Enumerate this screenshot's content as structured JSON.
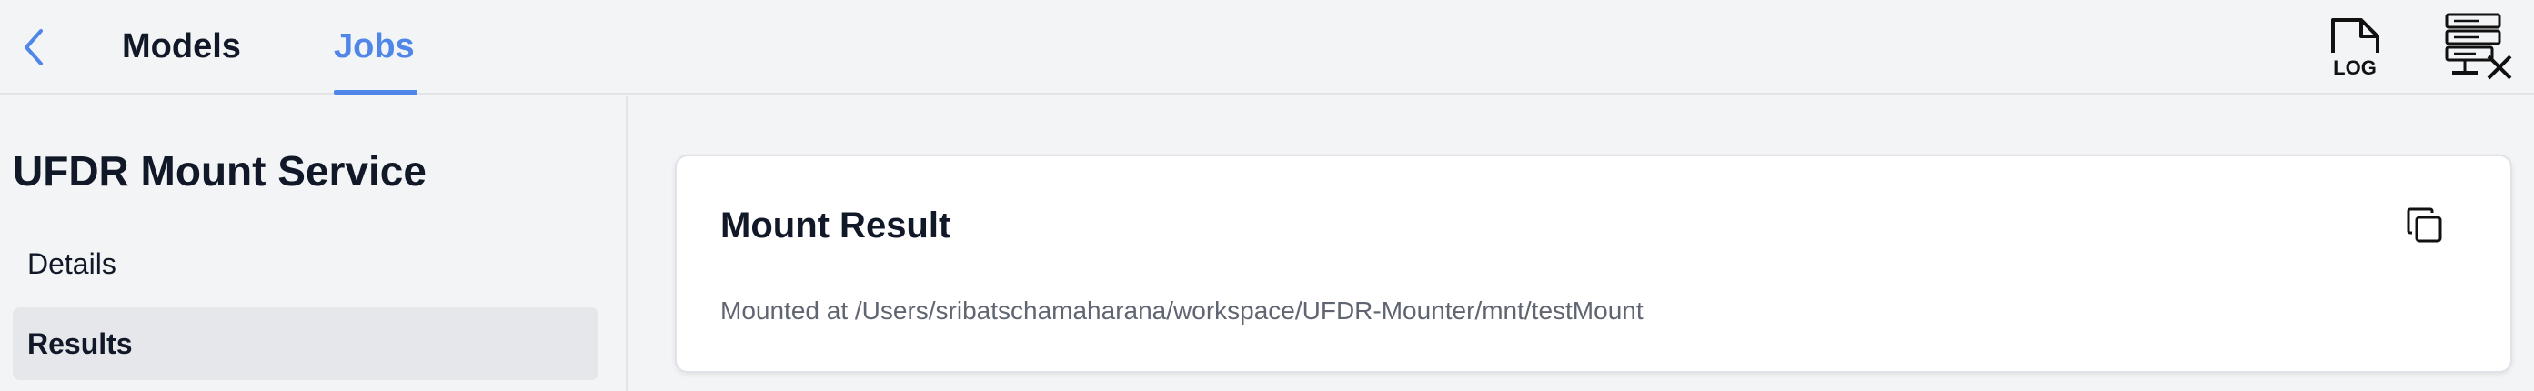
{
  "header": {
    "tabs": [
      {
        "label": "Models",
        "active": false
      },
      {
        "label": "Jobs",
        "active": true
      }
    ],
    "back_icon": "chevron-left-icon",
    "log_icon_text": "LOG",
    "server_icon": "server-tools-icon"
  },
  "sidebar": {
    "title": "UFDR Mount Service",
    "items": [
      {
        "label": "Details",
        "selected": false
      },
      {
        "label": "Results",
        "selected": true
      }
    ]
  },
  "card": {
    "title": "Mount Result",
    "message": "Mounted at /Users/sribatschamaharana/workspace/UFDR-Mounter/mnt/testMount",
    "copy_icon": "copy-icon"
  },
  "colors": {
    "accent": "#4f86e8",
    "background": "#f3f4f6",
    "selected_item": "#e5e7eb",
    "muted_text": "#5f6672"
  }
}
